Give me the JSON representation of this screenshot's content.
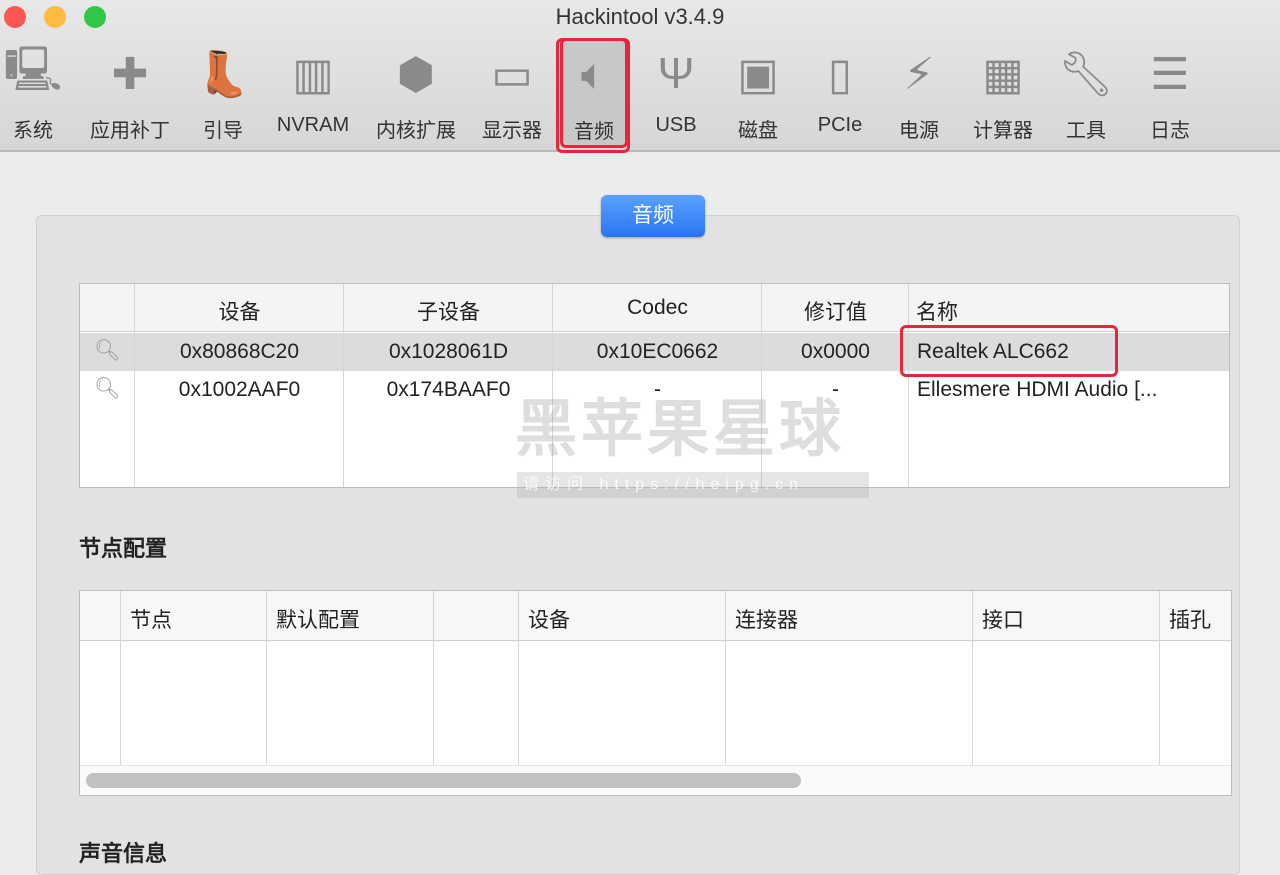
{
  "window": {
    "title": "Hackintool v3.4.9"
  },
  "toolbar": [
    {
      "label": "系统",
      "icon": "computer-icon"
    },
    {
      "label": "应用补丁",
      "icon": "bandage-icon"
    },
    {
      "label": "引导",
      "icon": "boot-icon"
    },
    {
      "label": "NVRAM",
      "icon": "nvram-icon"
    },
    {
      "label": "内核扩展",
      "icon": "lego-icon"
    },
    {
      "label": "显示器",
      "icon": "monitor-icon"
    },
    {
      "label": "音频",
      "icon": "speaker-icon",
      "selected": true
    },
    {
      "label": "USB",
      "icon": "usb-icon"
    },
    {
      "label": "磁盘",
      "icon": "disk-icon"
    },
    {
      "label": "PCIe",
      "icon": "pcie-icon"
    },
    {
      "label": "电源",
      "icon": "power-icon"
    },
    {
      "label": "计算器",
      "icon": "calculator-icon"
    },
    {
      "label": "工具",
      "icon": "wrench-icon"
    },
    {
      "label": "日志",
      "icon": "log-icon"
    }
  ],
  "segment": {
    "label": "音频"
  },
  "audio_table": {
    "headers": [
      "",
      "设备",
      "子设备",
      "Codec",
      "修订值",
      "名称"
    ],
    "rows": [
      {
        "device": "0x80868C20",
        "subdevice": "0x1028061D",
        "codec": "0x10EC0662",
        "revision": "0x0000",
        "name": "Realtek ALC662",
        "selected": true
      },
      {
        "device": "0x1002AAF0",
        "subdevice": "0x174BAAF0",
        "codec": "-",
        "revision": "-",
        "name": "Ellesmere HDMI Audio [..."
      }
    ]
  },
  "node_section": {
    "title": "节点配置",
    "headers": [
      "",
      "节点",
      "默认配置",
      "",
      "设备",
      "连接器",
      "接口",
      "插孔"
    ]
  },
  "sound_section": {
    "title": "声音信息"
  },
  "watermark": {
    "text": "黑苹果星球",
    "sub": "请访问 https://heipg.cn"
  },
  "colors": {
    "accent": "#2a74f0",
    "highlight": "#e8253a"
  }
}
